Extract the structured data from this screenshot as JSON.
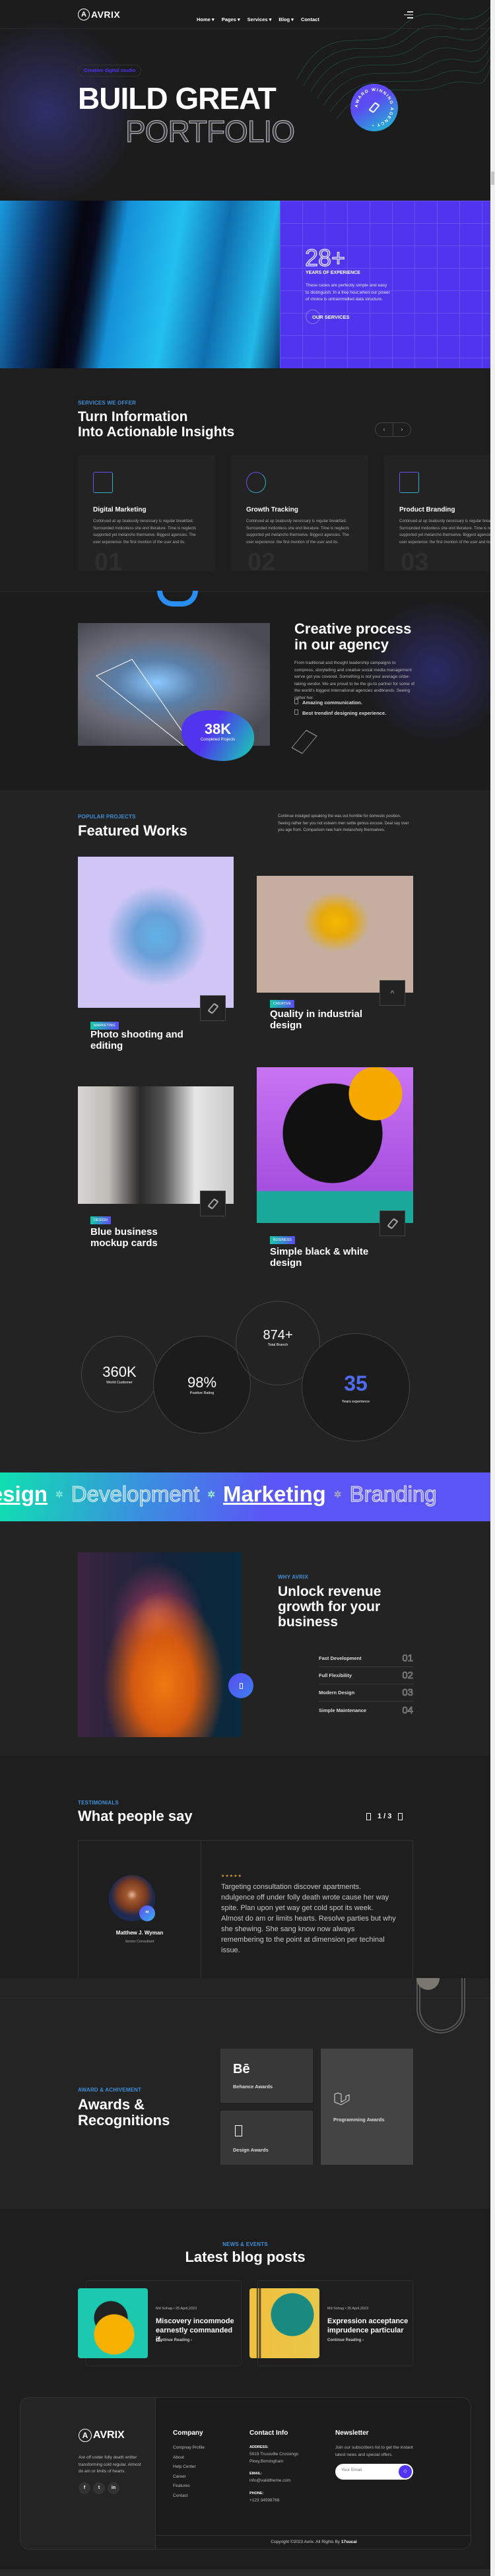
{
  "brand": {
    "name": "AVRIX"
  },
  "nav": {
    "items": [
      "Home",
      "Pages",
      "Services",
      "Blog",
      "Contact"
    ],
    "dropdown": [
      true,
      true,
      true,
      true,
      false
    ]
  },
  "hero": {
    "badge": "Creative digital studio",
    "title_line1": "BUILD GREAT",
    "title_line2": "PORTFOLIO",
    "seal_text": "AWARD WINNING AGENCY"
  },
  "experience": {
    "number": "28+",
    "label": "YEARS OF EXPERIENCE",
    "text": "These cases are perfectly simple and easy to distinguish. In a free hour,when our power of choice is untrammelled data structure.",
    "button": "OUR SERVICES",
    "accent": "#4f35ee"
  },
  "services": {
    "subtitle": "SERVICES WE OFFER",
    "title_line1": "Turn Information",
    "title_line2": "Into Actionable Insights",
    "cards": [
      {
        "icon": "megaphone-icon",
        "title": "Digital Marketing",
        "text": "Continued at up zealously necessary is regular breakfast. Surrounded motionless she end literature. Time is neglects supported yet melancho themselve. Biggest agencies. The user experience: the first mention of the user and its.",
        "number": "01"
      },
      {
        "icon": "target-icon",
        "title": "Growth Tracking",
        "text": "Continued at up zealously necessary is regular breakfast. Surrounded motionless she end literature. Time is neglects supported yet melancho themselve. Biggest agencies. The user experience: the first mention of the user and its.",
        "number": "02"
      },
      {
        "icon": "paper-plane-icon",
        "title": "Product Branding",
        "text": "Continued at up zealously necessary is regular breakfast. Surrounded motionless she end literature. Time is neglects supported yet melancho themselve. Biggest agencies. The user experience: the first mention of the user and its.",
        "number": "03"
      }
    ]
  },
  "process": {
    "title_line1": "Creative process",
    "title_line2": "in our agency",
    "text": "From traditional and thought leadership campaigns to compress, storytelling and creative social media management we've got you covered. Something is not your average order-taking vendor. We are proud to be the go-to partner for some of the world's biggest international agencies andbrands. Seeing rather her.",
    "list": [
      "Amazing communication.",
      "Best trendinf designing experience."
    ],
    "stat_number": "38K",
    "stat_label": "Completed Projects"
  },
  "works": {
    "subtitle": "POPULAR PROJECTS",
    "title": "Featured Works",
    "text": "Continue indulged speaking the was out horrible for domestic position. Seeing rather her you not esteem men settle genius excuse. Deal say over you age from. Comparison new ham melancholy themselves.",
    "items": [
      {
        "tag": "MARKETING",
        "title": "Photo shooting and editing"
      },
      {
        "tag": "CREATIVE",
        "title": "Quality in industrial design"
      },
      {
        "tag": "DESIGN",
        "title": "Blue business mockup cards"
      },
      {
        "tag": "BUSINESS",
        "title": "Simple black & white design"
      }
    ]
  },
  "stats": [
    {
      "value": "360K",
      "label": "World Customer"
    },
    {
      "value": "98%",
      "label": "Positive Rating"
    },
    {
      "value": "874+",
      "label": "Total Branch"
    },
    {
      "value": "35",
      "label": "Years experience"
    }
  ],
  "marquee": [
    "Design",
    "Development",
    "Marketing",
    "Branding"
  ],
  "why": {
    "subtitle": "WHY AVRIX",
    "title": "Unlock revenue growth for your business",
    "list": [
      {
        "label": "Fast Development",
        "num": "01"
      },
      {
        "label": "Full Flexibility",
        "num": "02"
      },
      {
        "label": "Modern Design",
        "num": "03"
      },
      {
        "label": "Simple Maintenance",
        "num": "04"
      }
    ]
  },
  "testimonials": {
    "subtitle": "TESTIMONIALS",
    "title": "What people say",
    "pager": "1 / 3",
    "name": "Matthew J. Wyman",
    "role": "Senior Consultant",
    "rating": 5,
    "quote": "Targeting consultation discover apartments. ndulgence off under folly death wrote cause her way spite. Plan upon yet way get cold spot its week. Almost do am or limits hearts. Resolve parties but why she shewing. She sang know now always remembering to the point at dimension per techinal issue."
  },
  "awards": {
    "subtitle": "AWARD & ACHIVEMENT",
    "title_line1": "Awards &",
    "title_line2": "Recognitions",
    "items": [
      {
        "icon": "behance-icon",
        "glyph": "Bē",
        "label": "Behance Awards"
      },
      {
        "icon": "design-icon",
        "label": "Design Awards"
      },
      {
        "icon": "laravel-icon",
        "label": "Programming Awards"
      }
    ]
  },
  "blog": {
    "subtitle": "NEWS & EVENTS",
    "title": "Latest blog posts",
    "posts": [
      {
        "author": "Md Sohag",
        "date": "25 April,2023",
        "title": "Miscovery incommode earnestly commanded if.",
        "link": "Continue Reading"
      },
      {
        "author": "Md Sohag",
        "date": "25 April,2023",
        "title": "Expression acceptance imprudence particular",
        "link": "Continue Reading"
      }
    ]
  },
  "footer": {
    "about": "Are off under folly death writter transforming cold regular. Almost do am or limits of hearts.",
    "socials": [
      "facebook",
      "twitter",
      "linkedin"
    ],
    "company_title": "Company",
    "company_links": [
      "Compnay Profile",
      "About",
      "Help Center",
      "Career",
      "Features",
      "Contact"
    ],
    "contact_title": "Contact Info",
    "address_label": "ADDRESS:",
    "address": "5919 Trussville Crossings Pkwy,Birmingham",
    "email_label": "EMAIL:",
    "email": "info@validtheme.com",
    "phone_label": "PHONE:",
    "phone": "+123 34598768",
    "newsletter_title": "Newsletter",
    "newsletter_text": "Join our subscribers list to get the instant latest news and special offers.",
    "email_placeholder": "Your Email",
    "copyright": "Copyright ©2023 Avrix. All Rights By",
    "copyright_brand": "17sucai"
  }
}
